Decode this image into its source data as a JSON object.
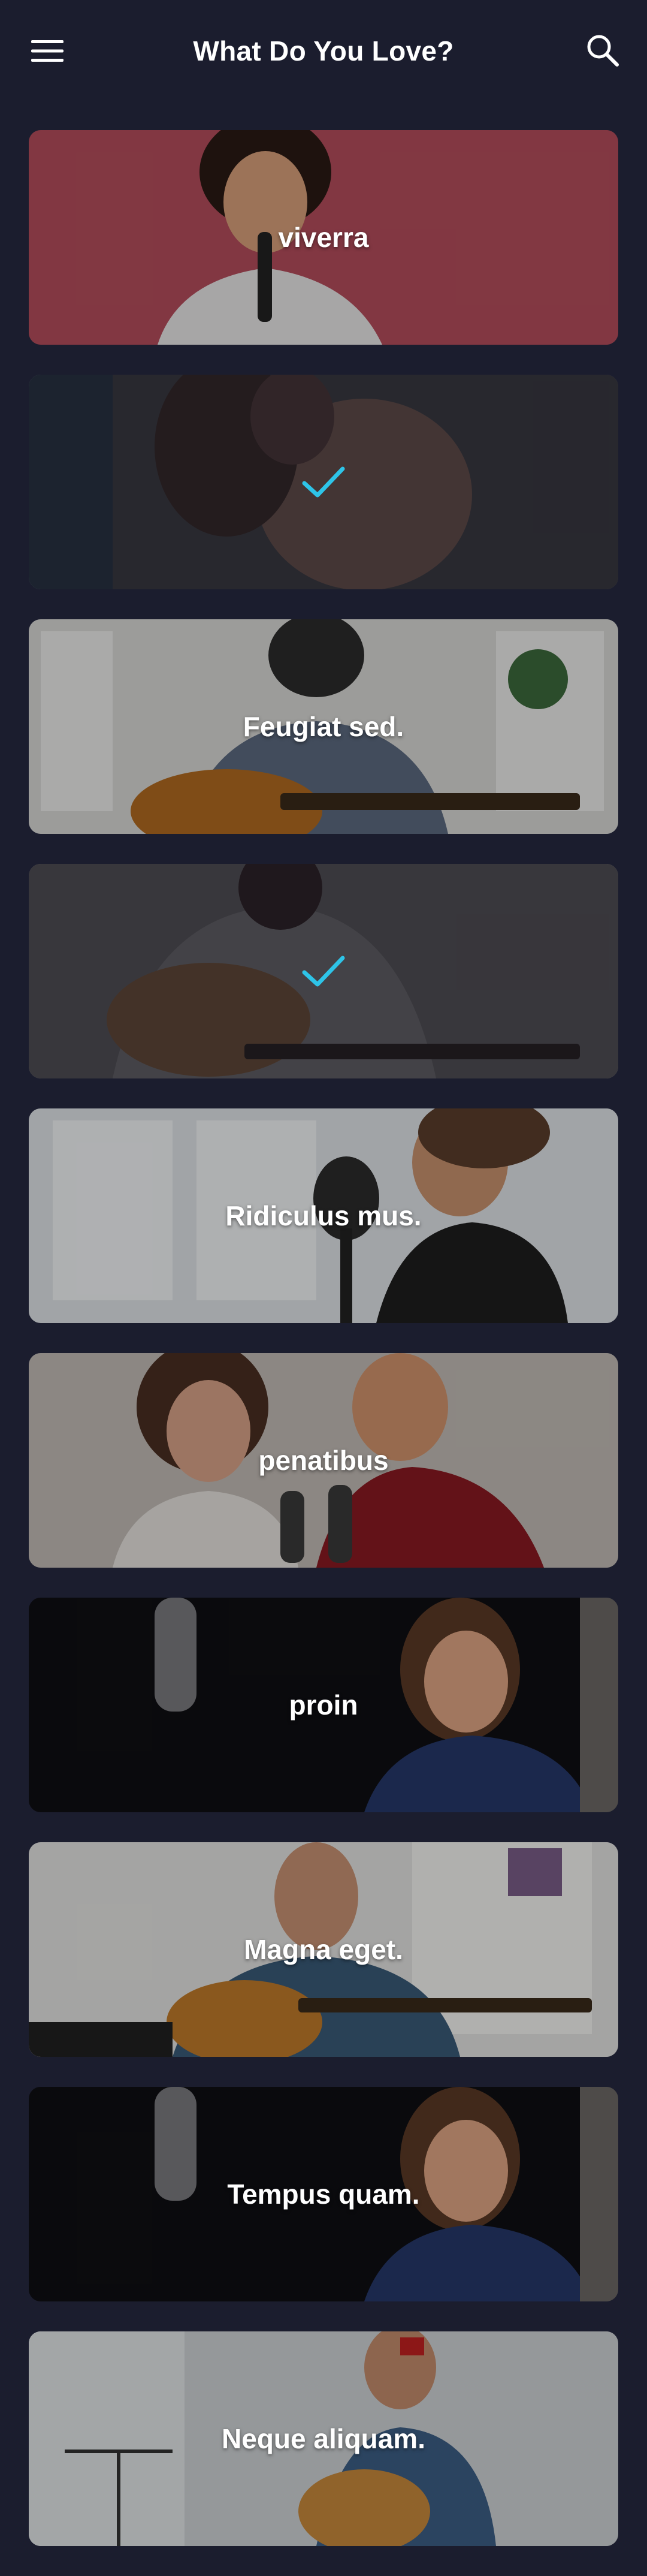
{
  "header": {
    "title": "What Do You Love?",
    "menu_icon": "hamburger-menu-icon",
    "search_icon": "search-icon"
  },
  "colors": {
    "background": "#1b1d2e",
    "check_accent": "#2ec4e8"
  },
  "cards": [
    {
      "label": "viverra",
      "selected": false,
      "image": "man singing into microphone on pink background"
    },
    {
      "label": "",
      "selected": true,
      "image": "woman with headphones"
    },
    {
      "label": "Feugiat sed.",
      "selected": false,
      "image": "man in beanie playing acoustic guitar"
    },
    {
      "label": "",
      "selected": true,
      "image": "man playing acoustic guitar"
    },
    {
      "label": "Ridiculus mus.",
      "selected": false,
      "image": "woman singing into studio microphone"
    },
    {
      "label": "penatibus",
      "selected": false,
      "image": "couple singing with microphones and headphones"
    },
    {
      "label": "proin",
      "selected": false,
      "image": "woman with headphones in studio"
    },
    {
      "label": "Magna eget.",
      "selected": false,
      "image": "man with headphones and guitar"
    },
    {
      "label": "Tempus quam.",
      "selected": false,
      "image": "woman with headphones in studio"
    },
    {
      "label": "Neque aliquam.",
      "selected": false,
      "image": "man playing guitar by sheet music"
    }
  ]
}
